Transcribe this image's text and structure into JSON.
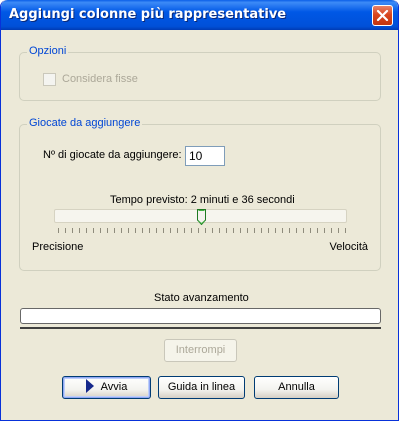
{
  "window": {
    "title": "Aggiungi colonne più rappresentative",
    "close_icon": "close-icon"
  },
  "options_group": {
    "title": "Opzioni",
    "consider_fixed": {
      "label": "Considera fisse",
      "checked": false,
      "enabled": false
    }
  },
  "plays_group": {
    "title": "Giocate da aggiungere",
    "count_label": "Nº di giocate da aggiungere:",
    "count_value": "10",
    "estimated_time": "Tempo previsto: 2 minuti e 36 secondi",
    "slider": {
      "min_label": "Precisione",
      "max_label": "Velocità",
      "level": 0.5
    }
  },
  "progress": {
    "label": "Stato avanzamento",
    "value": 0,
    "fill_color": "#2bc02b"
  },
  "buttons": {
    "interrupt": "Interrompi",
    "start": "Avvia",
    "help": "Guida in linea",
    "cancel": "Annulla"
  }
}
